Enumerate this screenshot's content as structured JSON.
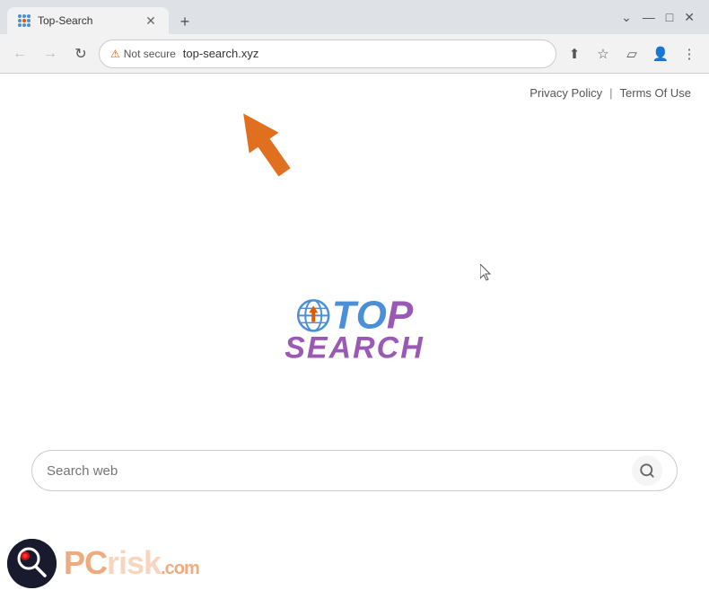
{
  "browser": {
    "tab": {
      "title": "Top-Search",
      "favicon": "grid-icon"
    },
    "new_tab_label": "+",
    "window_controls": {
      "minimize": "—",
      "maximize": "□",
      "close": "✕"
    },
    "nav": {
      "back_label": "←",
      "forward_label": "→",
      "reload_label": "↻",
      "security_label": "Not secure",
      "address": "top-search.xyz"
    }
  },
  "page": {
    "links": {
      "privacy_policy": "Privacy Policy",
      "divider": "|",
      "terms_of_use": "Terms Of Use"
    },
    "logo": {
      "top_text_t": "T",
      "top_text_o": "O",
      "top_text_p": "P",
      "search_text": "SEARCH"
    },
    "search": {
      "placeholder": "Search web",
      "button_icon": "🔍"
    }
  },
  "watermark": {
    "text_pc": "PC",
    "text_risk": "risk",
    "text_domain": ".com"
  }
}
